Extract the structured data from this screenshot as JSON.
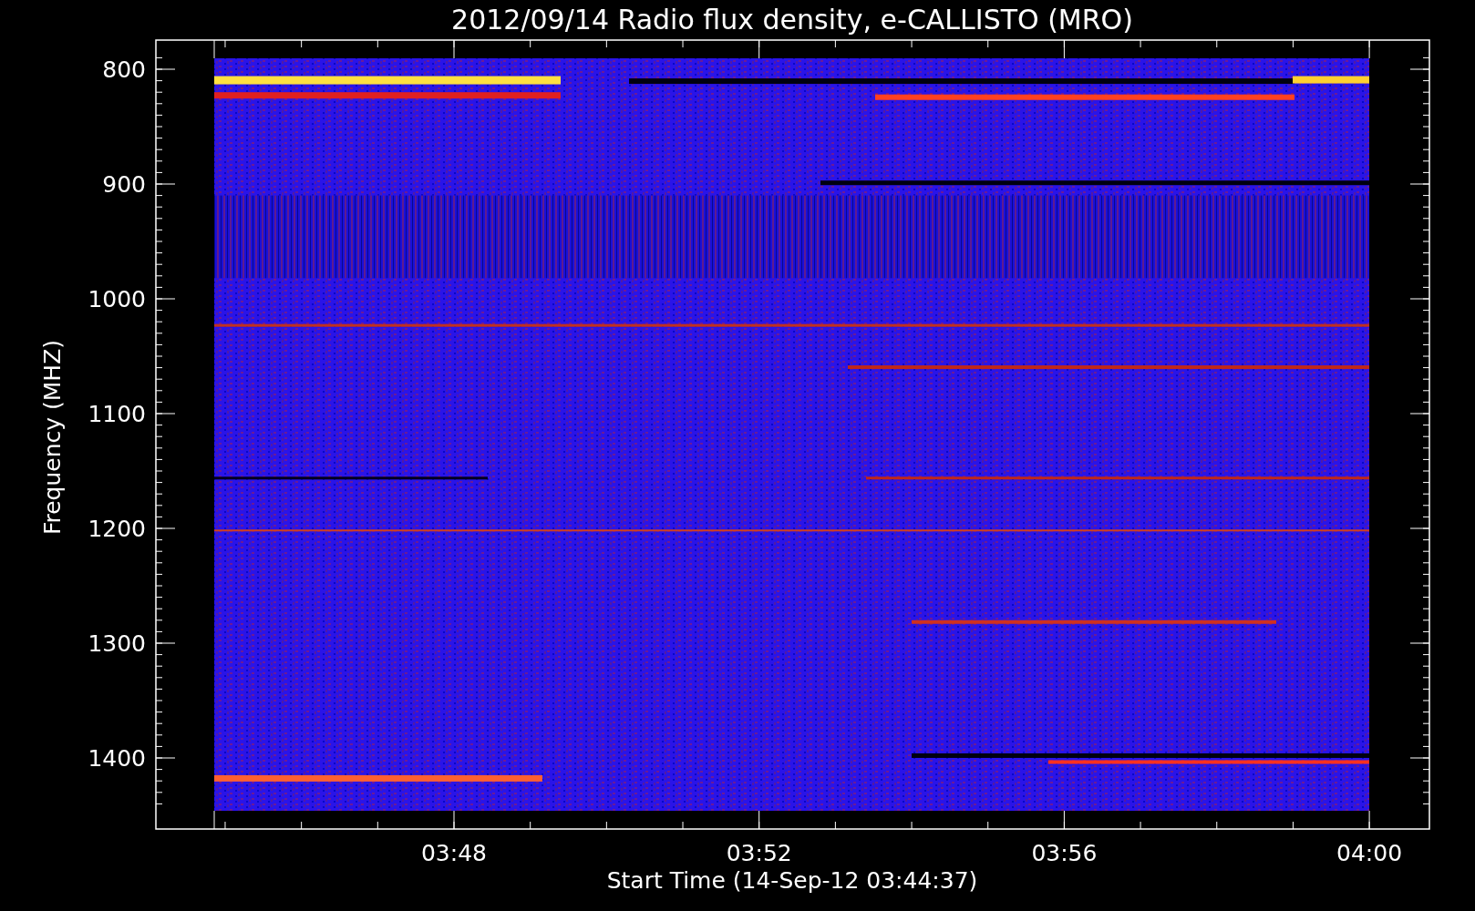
{
  "title": "2012/09/14  Radio flux density, e-CALLISTO (MRO)",
  "ylabel": "Frequency (MHZ)",
  "xlabel": "Start Time (14-Sep-12 03:44:37)",
  "yticks": [
    "800",
    "900",
    "1000",
    "1100",
    "1200",
    "1300",
    "1400"
  ],
  "xticks": [
    "03:48",
    "03:52",
    "03:56",
    "04:00"
  ]
}
